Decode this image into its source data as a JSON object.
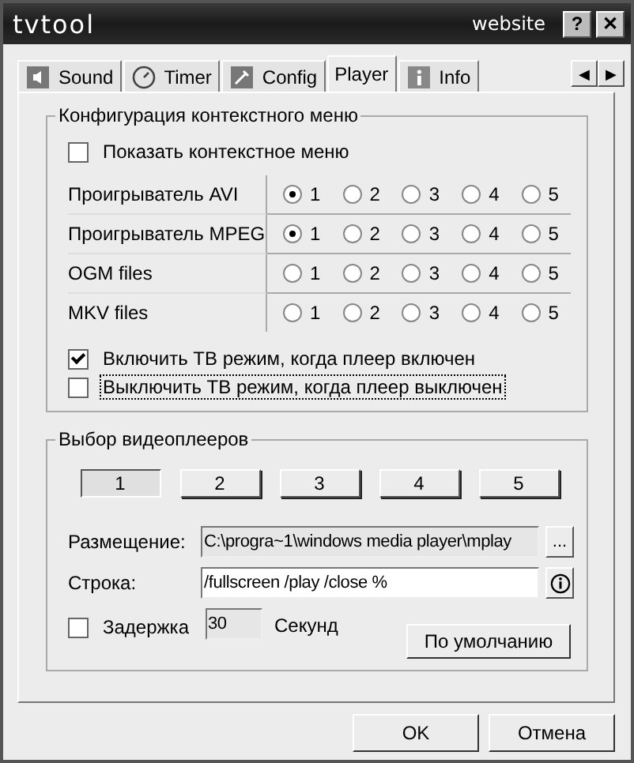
{
  "window": {
    "title": "tvtool",
    "link": "website",
    "buttons": [
      {
        "kind": "help",
        "label": "?"
      },
      {
        "kind": "close",
        "label": "✕"
      }
    ]
  },
  "tabs": [
    {
      "label": "Sound",
      "kind": "speaker",
      "selected": false
    },
    {
      "label": "Timer",
      "kind": "clock",
      "selected": false
    },
    {
      "label": "Config",
      "kind": "tools",
      "selected": false
    },
    {
      "label": "Player",
      "kind": "plain",
      "selected": true
    },
    {
      "label": "Info",
      "kind": "info",
      "selected": false
    }
  ],
  "tab_scroll": [
    "◀",
    "▶"
  ],
  "context_menu": {
    "title": "Конфигурация контекстного меню",
    "show": {
      "label": "Показать контекстное меню",
      "checked": false
    },
    "rows": [
      {
        "name": "Проигрыватель AVI",
        "options": [
          {
            "label": "1",
            "selected": true
          },
          {
            "label": "2",
            "selected": false
          },
          {
            "label": "3",
            "selected": false
          },
          {
            "label": "4",
            "selected": false
          },
          {
            "label": "5",
            "selected": false
          }
        ]
      },
      {
        "name": "Проигрыватель MPEG",
        "options": [
          {
            "label": "1",
            "selected": true
          },
          {
            "label": "2",
            "selected": false
          },
          {
            "label": "3",
            "selected": false
          },
          {
            "label": "4",
            "selected": false
          },
          {
            "label": "5",
            "selected": false
          }
        ]
      },
      {
        "name": "OGM files",
        "options": [
          {
            "label": "1",
            "selected": false
          },
          {
            "label": "2",
            "selected": false
          },
          {
            "label": "3",
            "selected": false
          },
          {
            "label": "4",
            "selected": false
          },
          {
            "label": "5",
            "selected": false
          }
        ]
      },
      {
        "name": "MKV files",
        "options": [
          {
            "label": "1",
            "selected": false
          },
          {
            "label": "2",
            "selected": false
          },
          {
            "label": "3",
            "selected": false
          },
          {
            "label": "4",
            "selected": false
          },
          {
            "label": "5",
            "selected": false
          }
        ]
      }
    ],
    "options": [
      {
        "label": "Включить ТВ режим, когда плеер включен",
        "checked": true,
        "focused": false
      },
      {
        "label": "Выключить ТВ режим, когда плеер выключен",
        "checked": false,
        "focused": true
      }
    ]
  },
  "players": {
    "title": "Выбор видеоплееров",
    "buttons": [
      {
        "label": "1",
        "selected": true
      },
      {
        "label": "2",
        "selected": false
      },
      {
        "label": "3",
        "selected": false
      },
      {
        "label": "4",
        "selected": false
      },
      {
        "label": "5",
        "selected": false
      }
    ],
    "location": {
      "label": "Размещение:",
      "value": "C:\\progra~1\\windows media player\\mplay",
      "browse": "..."
    },
    "command": {
      "label": "Строка:",
      "value": "/fullscreen /play /close %"
    },
    "delay": {
      "label": "Задержка",
      "checked": false,
      "value": "30",
      "unit": "Секунд"
    },
    "default_button": "По умолчанию"
  },
  "buttons": [
    "OK",
    "Отмена"
  ]
}
